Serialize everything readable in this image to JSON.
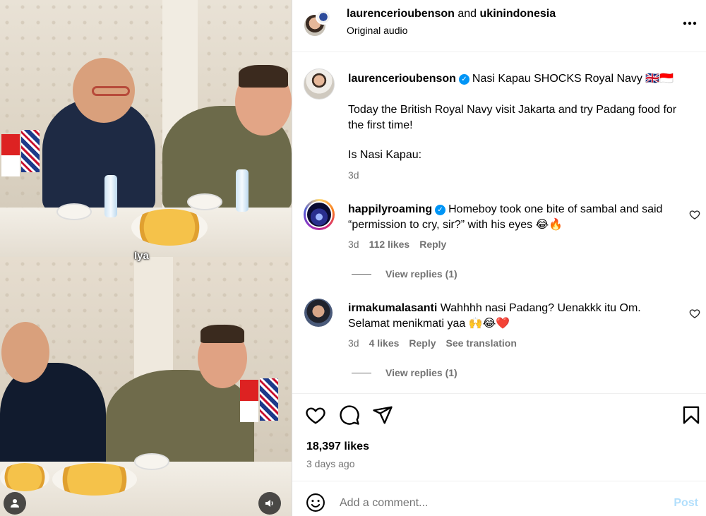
{
  "video": {
    "subtitle": "Iya"
  },
  "header": {
    "author": "laurencerioubenson",
    "connector": "and",
    "collaborator": "ukinindonesia",
    "audio": "Original audio"
  },
  "caption": {
    "username": "laurencerioubenson",
    "verified": true,
    "title": "Nasi Kapau SHOCKS Royal Navy",
    "title_flags": "🇬🇧🇮🇩",
    "body": "Today the British Royal Navy visit Jakarta and try Padang food for the first time!",
    "question": "Is Nasi Kapau:",
    "time": "3d"
  },
  "comments": [
    {
      "username": "happilyroaming",
      "verified": true,
      "text": "Homeboy took one bite of sambal and said “permission to cry, sir?” with his eyes 😂🔥",
      "time": "3d",
      "likes": "112 likes",
      "reply": "Reply",
      "view_replies": "View replies (1)"
    },
    {
      "username": "irmakumalasanti",
      "verified": false,
      "text": "Wahhhh nasi Padang? Uenakkk itu Om. Selamat menikmati yaa 🙌😂❤️",
      "time": "3d",
      "likes": "4 likes",
      "reply": "Reply",
      "translation": "See translation",
      "view_replies": "View replies (1)"
    }
  ],
  "stats": {
    "likes": "18,397 likes",
    "posted": "3 days ago"
  },
  "composer": {
    "placeholder": "Add a comment...",
    "post": "Post"
  },
  "colors": {
    "verified": "#0095f6",
    "muted": "#737373",
    "post_disabled": "#b2dffc"
  }
}
